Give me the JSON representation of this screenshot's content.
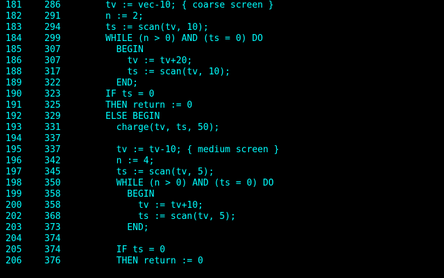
{
  "screen": {
    "foreground_color": "#00ffff",
    "background_color": "#000000",
    "lines": [
      {
        "line_no": "181",
        "addr": "286",
        "code": "tv := vec-10; { coarse screen }"
      },
      {
        "line_no": "182",
        "addr": "291",
        "code": "n := 2;"
      },
      {
        "line_no": "183",
        "addr": "294",
        "code": "ts := scan(tv, 10);"
      },
      {
        "line_no": "184",
        "addr": "299",
        "code": "WHILE (n > 0) AND (ts = 0) DO"
      },
      {
        "line_no": "185",
        "addr": "307",
        "code": "  BEGIN"
      },
      {
        "line_no": "186",
        "addr": "307",
        "code": "    tv := tv+20;"
      },
      {
        "line_no": "188",
        "addr": "317",
        "code": "    ts := scan(tv, 10);"
      },
      {
        "line_no": "189",
        "addr": "322",
        "code": "  END;"
      },
      {
        "line_no": "190",
        "addr": "323",
        "code": "IF ts = 0"
      },
      {
        "line_no": "191",
        "addr": "325",
        "code": "THEN return := 0"
      },
      {
        "line_no": "192",
        "addr": "329",
        "code": "ELSE BEGIN"
      },
      {
        "line_no": "193",
        "addr": "331",
        "code": "  charge(tv, ts, 50);"
      },
      {
        "line_no": "194",
        "addr": "337",
        "code": ""
      },
      {
        "line_no": "195",
        "addr": "337",
        "code": "  tv := tv-10; { medium screen }"
      },
      {
        "line_no": "196",
        "addr": "342",
        "code": "  n := 4;"
      },
      {
        "line_no": "197",
        "addr": "345",
        "code": "  ts := scan(tv, 5);"
      },
      {
        "line_no": "198",
        "addr": "350",
        "code": "  WHILE (n > 0) AND (ts = 0) DO"
      },
      {
        "line_no": "199",
        "addr": "358",
        "code": "    BEGIN"
      },
      {
        "line_no": "200",
        "addr": "358",
        "code": "      tv := tv+10;"
      },
      {
        "line_no": "202",
        "addr": "368",
        "code": "      ts := scan(tv, 5);"
      },
      {
        "line_no": "203",
        "addr": "373",
        "code": "    END;"
      },
      {
        "line_no": "204",
        "addr": "374",
        "code": ""
      },
      {
        "line_no": "205",
        "addr": "374",
        "code": "  IF ts = 0"
      },
      {
        "line_no": "206",
        "addr": "376",
        "code": "  THEN return := 0"
      }
    ]
  }
}
